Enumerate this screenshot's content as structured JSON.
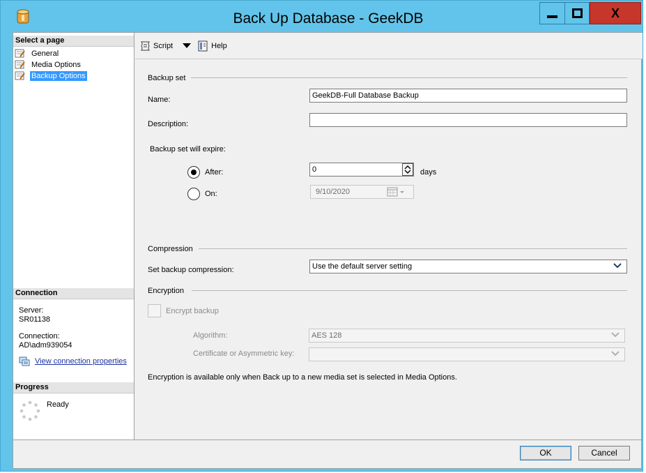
{
  "window": {
    "title": "Back Up Database - GeekDB",
    "close_glyph": "X"
  },
  "left_pane": {
    "select_page_header": "Select a page",
    "pages": [
      {
        "label": "General",
        "icon": "page-wrench-icon"
      },
      {
        "label": "Media Options",
        "icon": "page-wrench-icon"
      },
      {
        "label": "Backup Options",
        "icon": "page-wrench-icon",
        "selected": true
      }
    ],
    "connection_header": "Connection",
    "server_label": "Server:",
    "server_value": "SR01138",
    "connection_label": "Connection:",
    "connection_value": "AD\\adm939054",
    "view_connection_link": "View connection properties",
    "progress_header": "Progress",
    "progress_status": "Ready"
  },
  "toolbar": {
    "script_label": "Script",
    "help_label": "Help"
  },
  "backup_set": {
    "group_title": "Backup set",
    "name_label": "Name:",
    "name_value": "GeekDB-Full Database Backup",
    "description_label": "Description:",
    "description_value": "",
    "expire_label": "Backup set will expire:",
    "after_label": "After:",
    "after_value": "0",
    "days_label": "days",
    "on_label": "On:",
    "on_value": "9/10/2020",
    "selected_option": "after"
  },
  "compression": {
    "group_title": "Compression",
    "label": "Set backup compression:",
    "selected": "Use the default server setting"
  },
  "encryption": {
    "group_title": "Encryption",
    "encrypt_label": "Encrypt backup",
    "encrypt_checked": false,
    "algorithm_label": "Algorithm:",
    "algorithm_value": "AES 128",
    "certificate_label": "Certificate or Asymmetric key:",
    "certificate_value": "",
    "note": "Encryption is available only when Back up to a new media set is selected in Media Options."
  },
  "buttons": {
    "ok": "OK",
    "cancel": "Cancel"
  },
  "colors": {
    "title_bar": "#62c4ea",
    "close_button": "#c7362b",
    "selection": "#3399ff",
    "link": "#1a33a0"
  }
}
